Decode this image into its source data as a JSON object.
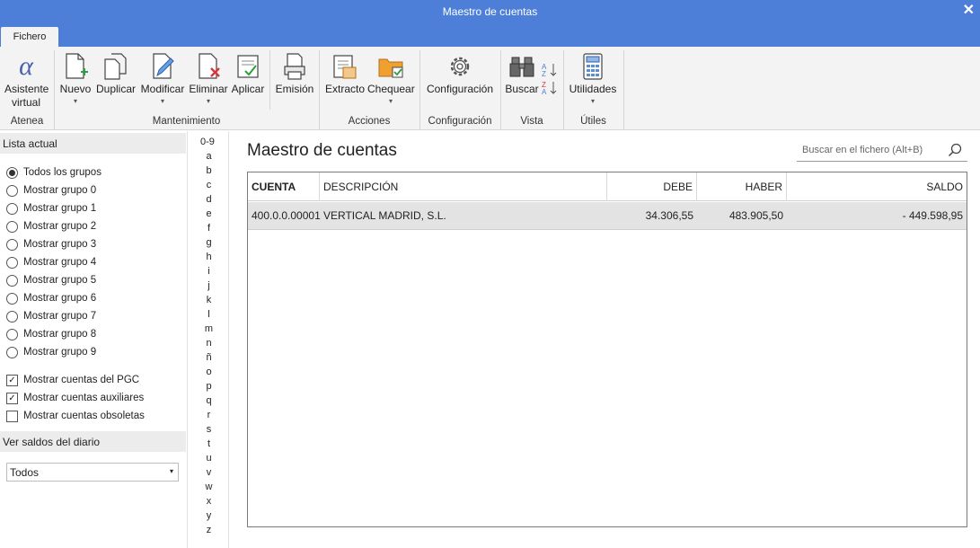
{
  "window": {
    "title": "Maestro de cuentas",
    "close": "✕"
  },
  "tabs": [
    {
      "label": "Fichero"
    }
  ],
  "ribbon": {
    "buttons": {
      "asistente_line1": "Asistente",
      "asistente_line2": "virtual",
      "nuevo": "Nuevo",
      "duplicar": "Duplicar",
      "modificar": "Modificar",
      "eliminar": "Eliminar",
      "aplicar": "Aplicar",
      "emision": "Emisión",
      "extracto": "Extracto",
      "chequear": "Chequear",
      "configuracion": "Configuración",
      "buscar": "Buscar",
      "utilidades": "Utilidades"
    },
    "groups": {
      "atenea": "Atenea",
      "mantenimiento": "Mantenimiento",
      "acciones": "Acciones",
      "configuracion": "Configuración",
      "vista": "Vista",
      "utiles": "Útiles"
    },
    "dropdown_glyph": "▾"
  },
  "left": {
    "lista_header": "Lista actual",
    "radios": [
      {
        "label": "Todos los grupos",
        "selected": true
      },
      {
        "label": "Mostrar grupo 0",
        "selected": false
      },
      {
        "label": "Mostrar grupo 1",
        "selected": false
      },
      {
        "label": "Mostrar grupo 2",
        "selected": false
      },
      {
        "label": "Mostrar grupo 3",
        "selected": false
      },
      {
        "label": "Mostrar grupo 4",
        "selected": false
      },
      {
        "label": "Mostrar grupo 5",
        "selected": false
      },
      {
        "label": "Mostrar grupo 6",
        "selected": false
      },
      {
        "label": "Mostrar grupo 7",
        "selected": false
      },
      {
        "label": "Mostrar grupo 8",
        "selected": false
      },
      {
        "label": "Mostrar grupo 9",
        "selected": false
      }
    ],
    "checks": [
      {
        "label": "Mostrar cuentas del PGC",
        "checked": true
      },
      {
        "label": "Mostrar cuentas auxiliares",
        "checked": true
      },
      {
        "label": "Mostrar cuentas obsoletas",
        "checked": false
      }
    ],
    "saldos_header": "Ver saldos del diario",
    "saldos_select": "Todos"
  },
  "alphabet": [
    "0-9",
    "a",
    "b",
    "c",
    "d",
    "e",
    "f",
    "g",
    "h",
    "i",
    "j",
    "k",
    "l",
    "m",
    "n",
    "ñ",
    "o",
    "p",
    "q",
    "r",
    "s",
    "t",
    "u",
    "v",
    "w",
    "x",
    "y",
    "z"
  ],
  "main": {
    "title": "Maestro de cuentas",
    "search_placeholder": "Buscar en el fichero (Alt+B)",
    "columns": [
      "CUENTA",
      "DESCRIPCIÓN",
      "DEBE",
      "HABER",
      "SALDO"
    ],
    "rows": [
      {
        "cuenta": "400.0.0.00001",
        "descripcion": "VERTICAL MADRID, S.L.",
        "debe": "34.306,55",
        "haber": "483.905,50",
        "saldo": "- 449.598,95"
      }
    ]
  },
  "colors": {
    "titlebar": "#4e7fd8",
    "ribbon_bg": "#f3f3f3",
    "selected_row": "#e3e3e3",
    "add_green": "#2e9e3e",
    "delete_red": "#d9333f",
    "folder_orange": "#f0a030",
    "alpha_blue": "#4a5fb0"
  },
  "icons": [
    "alpha-icon",
    "new-doc-icon",
    "duplicate-icon",
    "edit-icon",
    "delete-icon",
    "apply-icon",
    "print-icon",
    "extract-icon",
    "check-folder-icon",
    "gear-icon",
    "binoculars-icon",
    "sort-icon",
    "calculator-icon",
    "search-icon"
  ]
}
